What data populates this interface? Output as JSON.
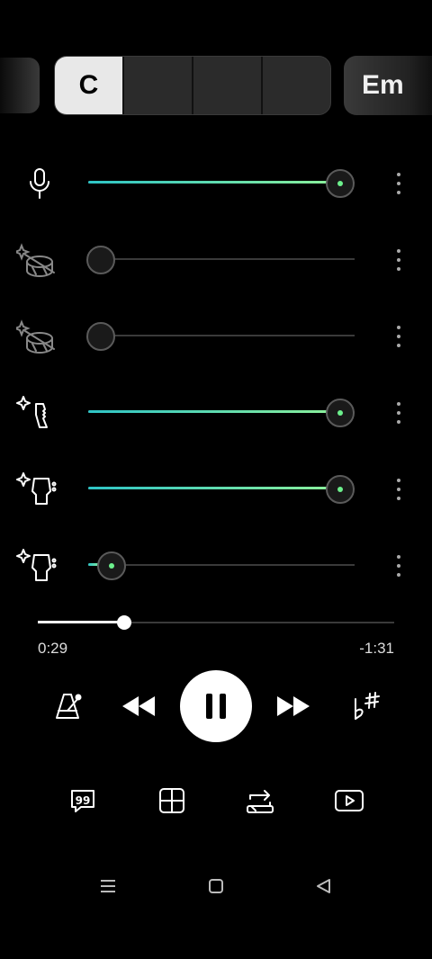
{
  "chords": {
    "current": "C",
    "next": "Em"
  },
  "tracks": [
    {
      "icon": "microphone-icon",
      "level": 1.0
    },
    {
      "icon": "drum-muted-icon",
      "level": 0.0
    },
    {
      "icon": "drum-muted-icon",
      "level": 0.0
    },
    {
      "icon": "bass-guitar-icon",
      "level": 1.0
    },
    {
      "icon": "guitar-icon",
      "level": 1.0
    },
    {
      "icon": "guitar-icon",
      "level": 0.08
    }
  ],
  "playback": {
    "elapsed": "0:29",
    "remaining": "-1:31",
    "progress": 0.24
  },
  "colors": {
    "accent_start": "#2ec4c6",
    "accent_end": "#8ef29a",
    "knob_dot": "#6cf08c"
  }
}
